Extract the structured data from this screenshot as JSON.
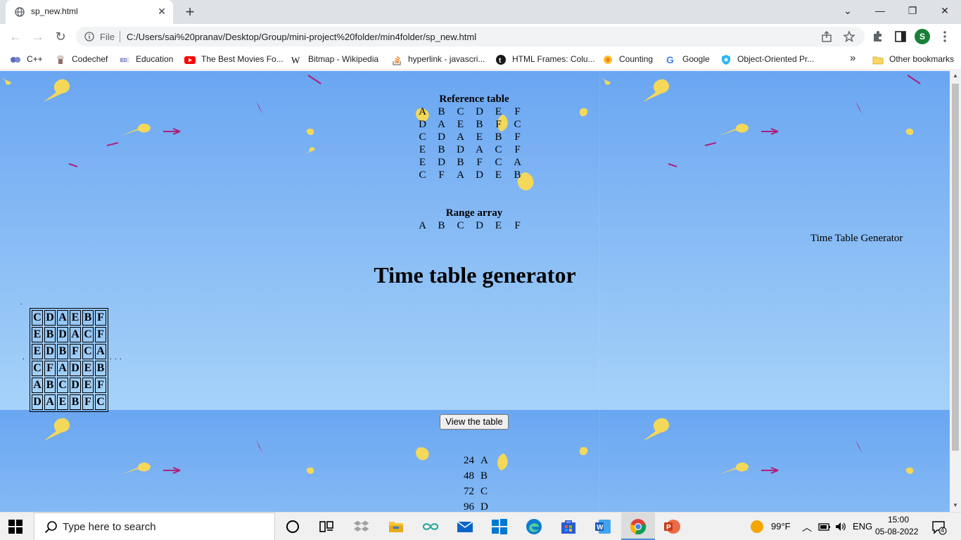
{
  "browser": {
    "tab_title": "sp_new.html",
    "tab_close": "✕",
    "new_tab": "+",
    "win_dropdown": "⌄",
    "win_minimize": "—",
    "win_restore": "❐",
    "win_close": "✕",
    "file_label": "File",
    "url": "C:/Users/sai%20pranav/Desktop/Group/mini-project%20folder/min4folder/sp_new.html",
    "profile_initial": "S"
  },
  "bookmarks": {
    "items": [
      "C++",
      "Codechef",
      "Education",
      "The Best Movies Fo...",
      "Bitmap - Wikipedia",
      "hyperlink - javascri...",
      "HTML Frames: Colu...",
      "Counting",
      "Google",
      "Object-Oriented Pr..."
    ],
    "overflow": "»",
    "other": "Other bookmarks"
  },
  "page": {
    "reference_title": "Reference table",
    "reference_table": [
      [
        "A",
        "B",
        "C",
        "D",
        "E",
        "F"
      ],
      [
        "D",
        "A",
        "E",
        "B",
        "F",
        "C"
      ],
      [
        "C",
        "D",
        "A",
        "E",
        "B",
        "F"
      ],
      [
        "E",
        "B",
        "D",
        "A",
        "C",
        "F"
      ],
      [
        "E",
        "D",
        "B",
        "F",
        "C",
        "A"
      ],
      [
        "C",
        "F",
        "A",
        "D",
        "E",
        "B"
      ]
    ],
    "range_title": "Range array",
    "range_array": [
      "A",
      "B",
      "C",
      "D",
      "E",
      "F"
    ],
    "main_title": "Time table generator",
    "side_text": "Time Table Generator",
    "timetable": [
      [
        "C",
        "D",
        "A",
        "E",
        "B",
        "F"
      ],
      [
        "E",
        "B",
        "D",
        "A",
        "C",
        "F"
      ],
      [
        "E",
        "D",
        "B",
        "F",
        "C",
        "A"
      ],
      [
        "C",
        "F",
        "A",
        "D",
        "E",
        "B"
      ],
      [
        "A",
        "B",
        "C",
        "D",
        "E",
        "F"
      ],
      [
        "D",
        "A",
        "E",
        "B",
        "F",
        "C"
      ]
    ],
    "dots_top": ".",
    "dots_left": ".",
    "dots_right": ". . .",
    "view_button": "View the table",
    "number_list": [
      {
        "n": "24",
        "l": "A"
      },
      {
        "n": "48",
        "l": "B"
      },
      {
        "n": "72",
        "l": "C"
      },
      {
        "n": "96",
        "l": "D"
      }
    ]
  },
  "taskbar": {
    "search_placeholder": "Type here to search",
    "weather": "99°F",
    "language": "ENG",
    "time": "15:00",
    "date": "05-08-2022",
    "notification_count": "4"
  },
  "colors": {
    "sky_top": "#6aa6f1",
    "sky_bottom": "#b7e0fa",
    "leaf_yellow": "#f3d85a",
    "leaf_magenta": "#b0207a",
    "chrome_tab_bg": "#dee1e6"
  }
}
